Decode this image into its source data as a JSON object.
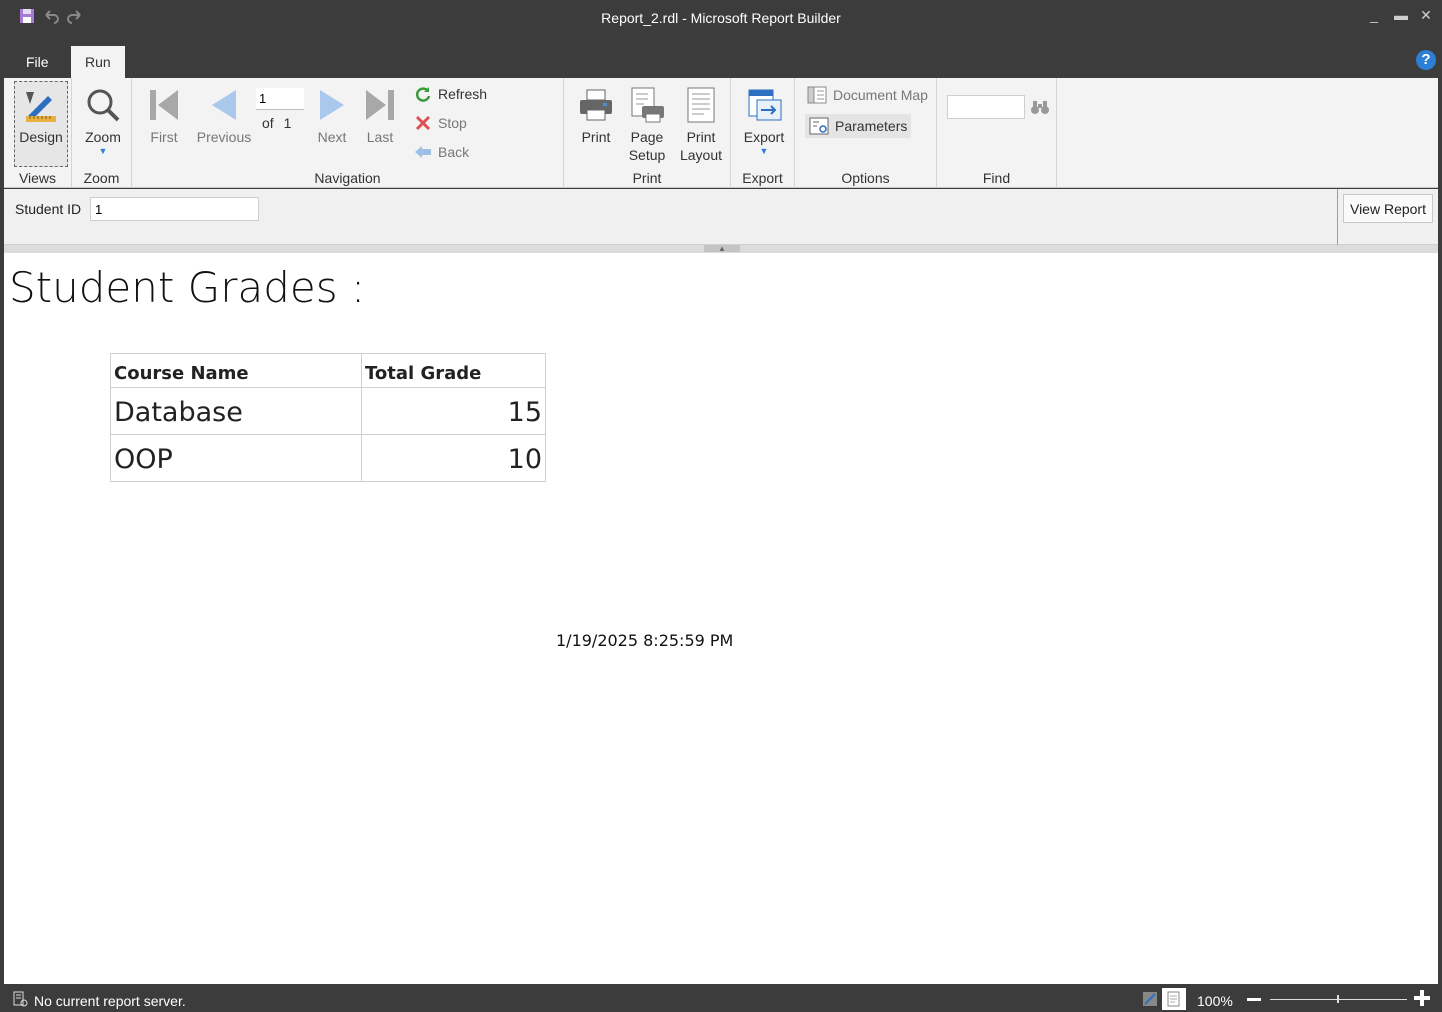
{
  "window": {
    "title": "Report_2.rdl - Microsoft Report Builder"
  },
  "menu": {
    "file_label": "File",
    "run_label": "Run"
  },
  "ribbon": {
    "views": {
      "design_label": "Design",
      "group_label": "Views"
    },
    "zoom": {
      "zoom_label": "Zoom",
      "group_label": "Zoom"
    },
    "navigation": {
      "first_label": "First",
      "previous_label": "Previous",
      "page_value": "1",
      "of_label": "of",
      "total_pages": "1",
      "next_label": "Next",
      "last_label": "Last",
      "refresh_label": "Refresh",
      "stop_label": "Stop",
      "back_label": "Back",
      "group_label": "Navigation"
    },
    "print": {
      "print_label": "Print",
      "page_setup_label_1": "Page",
      "page_setup_label_2": "Setup",
      "print_layout_label_1": "Print",
      "print_layout_label_2": "Layout",
      "group_label": "Print"
    },
    "export": {
      "export_label": "Export",
      "group_label": "Export"
    },
    "options": {
      "document_map_label": "Document Map",
      "parameters_label": "Parameters",
      "group_label": "Options"
    },
    "find": {
      "find_value": "",
      "group_label": "Find"
    }
  },
  "parameters": {
    "student_id_label": "Student ID",
    "student_id_value": "1",
    "view_report_label": "View Report"
  },
  "report": {
    "title": "Student Grades :",
    "table": {
      "headers": [
        "Course Name",
        "Total Grade"
      ],
      "rows": [
        [
          "Database",
          "15"
        ],
        [
          "OOP",
          "10"
        ]
      ]
    },
    "timestamp": "1/19/2025 8:25:59 PM"
  },
  "status": {
    "message": "No current report server.",
    "zoom": "100%"
  },
  "colors": {
    "chrome": "#3c3c3c",
    "ribbon": "#f3f3f3",
    "accent_blue": "#2d7ed6"
  }
}
